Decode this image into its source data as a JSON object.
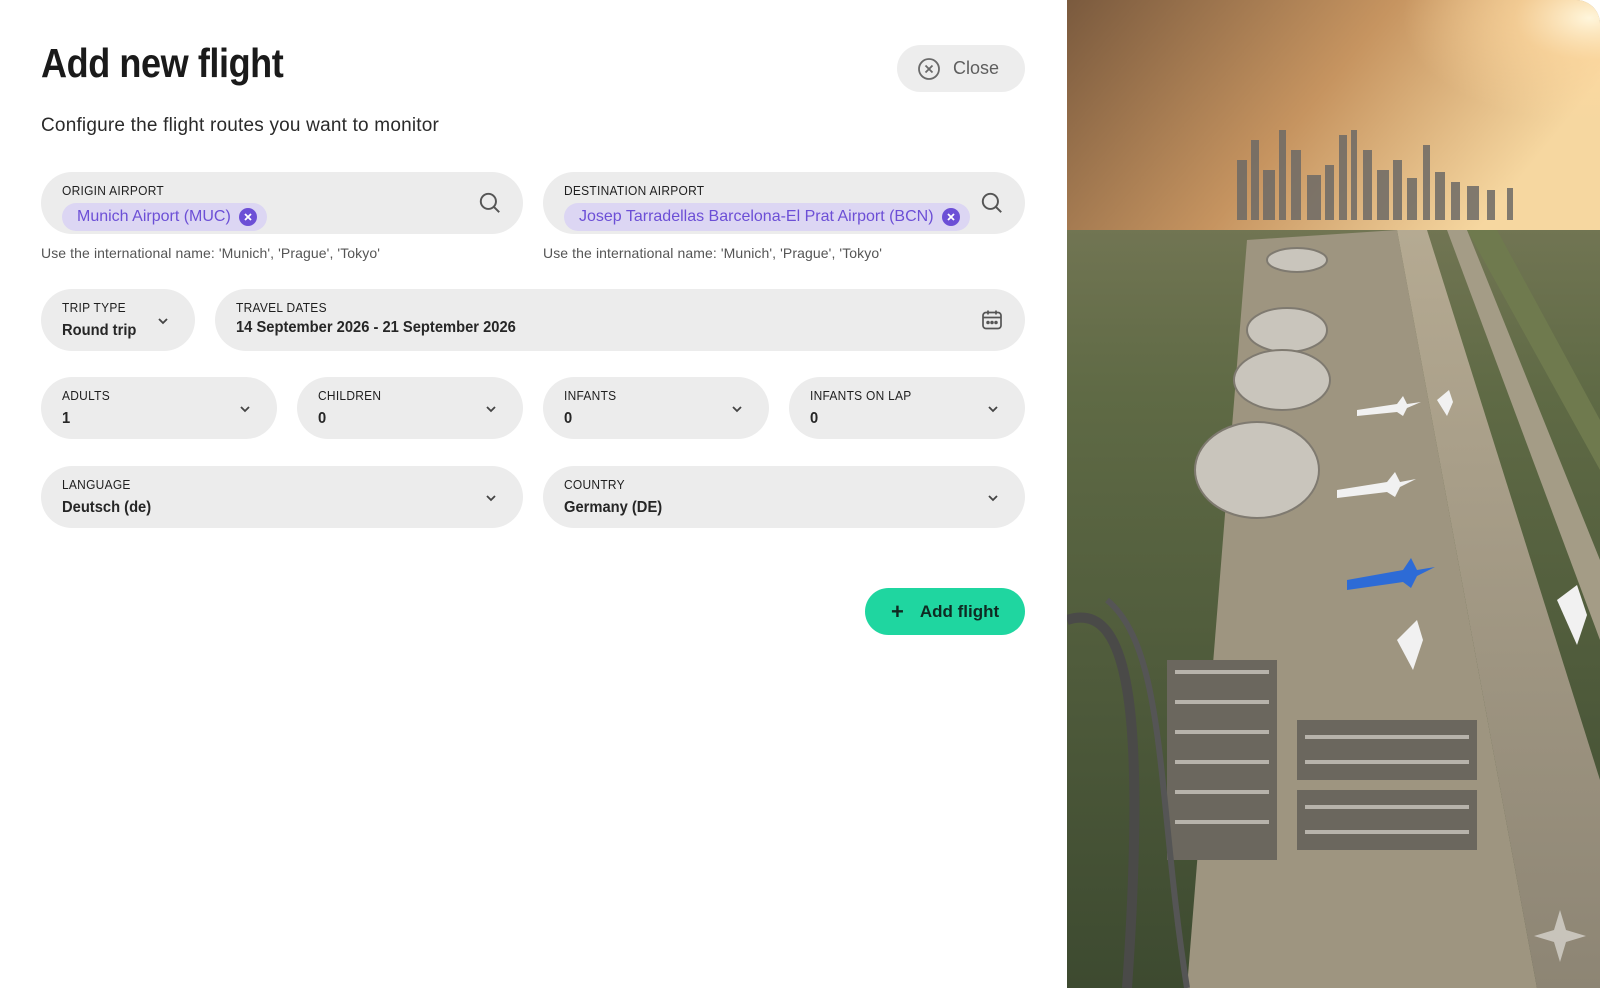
{
  "header": {
    "title": "Add new flight",
    "subtitle": "Configure the flight routes you want to monitor",
    "close_label": "Close"
  },
  "origin": {
    "label": "ORIGIN AIRPORT",
    "selected": "Munich Airport (MUC)",
    "hint": "Use the international name: 'Munich', 'Prague', 'Tokyo'"
  },
  "destination": {
    "label": "DESTINATION AIRPORT",
    "selected": "Josep Tarradellas Barcelona-El Prat Airport (BCN)",
    "hint": "Use the international name: 'Munich', 'Prague', 'Tokyo'"
  },
  "trip_type": {
    "label": "TRIP TYPE",
    "value": "Round trip"
  },
  "travel_dates": {
    "label": "TRAVEL DATES",
    "value": "14 September 2026 - 21 September 2026"
  },
  "passengers": {
    "adults": {
      "label": "ADULTS",
      "value": "1"
    },
    "children": {
      "label": "CHILDREN",
      "value": "0"
    },
    "infants": {
      "label": "INFANTS",
      "value": "0"
    },
    "infants_on_lap": {
      "label": "INFANTS ON LAP",
      "value": "0"
    }
  },
  "language": {
    "label": "LANGUAGE",
    "value": "Deutsch (de)"
  },
  "country": {
    "label": "COUNTRY",
    "value": "Germany (DE)"
  },
  "actions": {
    "add_flight_label": "Add flight"
  },
  "colors": {
    "accent": "#1fd6a0",
    "chip_bg": "#dcd6f3",
    "chip_text": "#6c4fd6",
    "field_bg": "#ececec"
  },
  "icons": {
    "close": "circle-x-icon",
    "search": "search-icon",
    "calendar": "calendar-icon",
    "chevron": "chevron-down-icon",
    "plus": "plus-icon",
    "chip_remove": "x-icon"
  }
}
